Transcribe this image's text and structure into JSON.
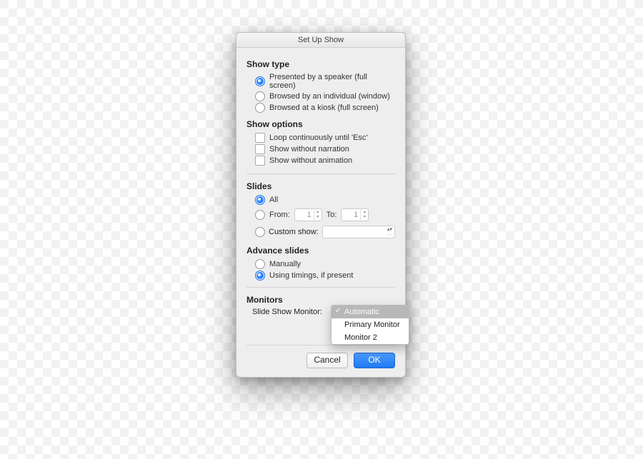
{
  "dialog": {
    "title": "Set Up Show",
    "showType": {
      "label": "Show type",
      "options": [
        "Presented by a speaker (full screen)",
        "Browsed by an individual (window)",
        "Browsed at a kiosk (full screen)"
      ]
    },
    "showOptions": {
      "label": "Show options",
      "options": [
        "Loop continuously until 'Esc'",
        "Show without narration",
        "Show without animation"
      ]
    },
    "slides": {
      "label": "Slides",
      "all": "All",
      "fromLabel": "From:",
      "fromValue": "1",
      "toLabel": "To:",
      "toValue": "1",
      "customLabel": "Custom show:"
    },
    "advance": {
      "label": "Advance slides",
      "options": [
        "Manually",
        "Using timings, if present"
      ]
    },
    "monitors": {
      "label": "Monitors",
      "rowLabel": "Slide Show Monitor:",
      "menu": [
        "Automatic",
        "Primary Monitor",
        "Monitor 2"
      ]
    },
    "buttons": {
      "cancel": "Cancel",
      "ok": "OK"
    }
  }
}
